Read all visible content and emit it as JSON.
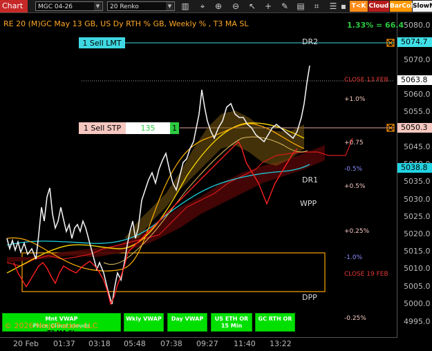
{
  "toolbar": {
    "chart_tab": "Chart",
    "instrument": "MGC 04-26",
    "bar_type": "20 Renko",
    "tk_label": "T<K",
    "cloud_label": "Cloud",
    "barcol_label": "BarCol",
    "slowm_label": "SlowM"
  },
  "chart": {
    "title": "RE 20  (M)GC May 13 GB, US Dy RTH % GB, Weekly % , T3 MA SL",
    "summary": "1.33% = 66.4",
    "y_ticks": [
      "5080.0",
      "5070.0",
      "5060.0",
      "5055.0",
      "5045.0",
      "5040.0",
      "5035.0",
      "5030.0",
      "5025.0",
      "5020.0",
      "5015.0",
      "5010.0",
      "5005.0",
      "5000.0",
      "4995.0"
    ],
    "x_ticks": [
      "20 Feb",
      "01:37",
      "03:18",
      "05:48",
      "07:38",
      "09:27",
      "11:40",
      "13:22"
    ],
    "price_tags": [
      {
        "text": "5074.7",
        "bg": "#40e0e8",
        "fg": "#000"
      },
      {
        "text": "5063.8",
        "bg": "#ffffff",
        "fg": "#000"
      },
      {
        "text": "5050.3",
        "bg": "#f5c7c0",
        "fg": "#000"
      },
      {
        "text": "5038.8",
        "bg": "#21d4e2",
        "fg": "#000"
      }
    ],
    "levels": {
      "dr2": "DR2",
      "dr1": "DR1",
      "wpp": "WPP",
      "dpp": "DPP",
      "close13": "CLOSE 13 FEB",
      "close19": "CLOSE 19 FEB"
    },
    "percent_labels": [
      "+1.0%",
      "+0.75",
      "-0.5%",
      "+0.5%",
      "+0.25%",
      "-1.0%",
      "-0.25%"
    ],
    "orders": {
      "sell_lmt": "1 Sell LMT",
      "sell_stp": "1 Sell STP",
      "stp_ticks": "135",
      "stp_qty": "1"
    }
  },
  "buttons": {
    "mnt_vwap": "Mnt VWAP",
    "price_cloud": "Price Cloud clouds",
    "t3": "T3 MA SL",
    "wkly_vwap": "Wkly VWAP",
    "day_vwap": "Day VWAP",
    "us_eth": "US ETH OR 15 Min",
    "gc_rth": "GC RTH OR"
  },
  "copyright": "© 2026 NinjaTrader, LLC"
}
